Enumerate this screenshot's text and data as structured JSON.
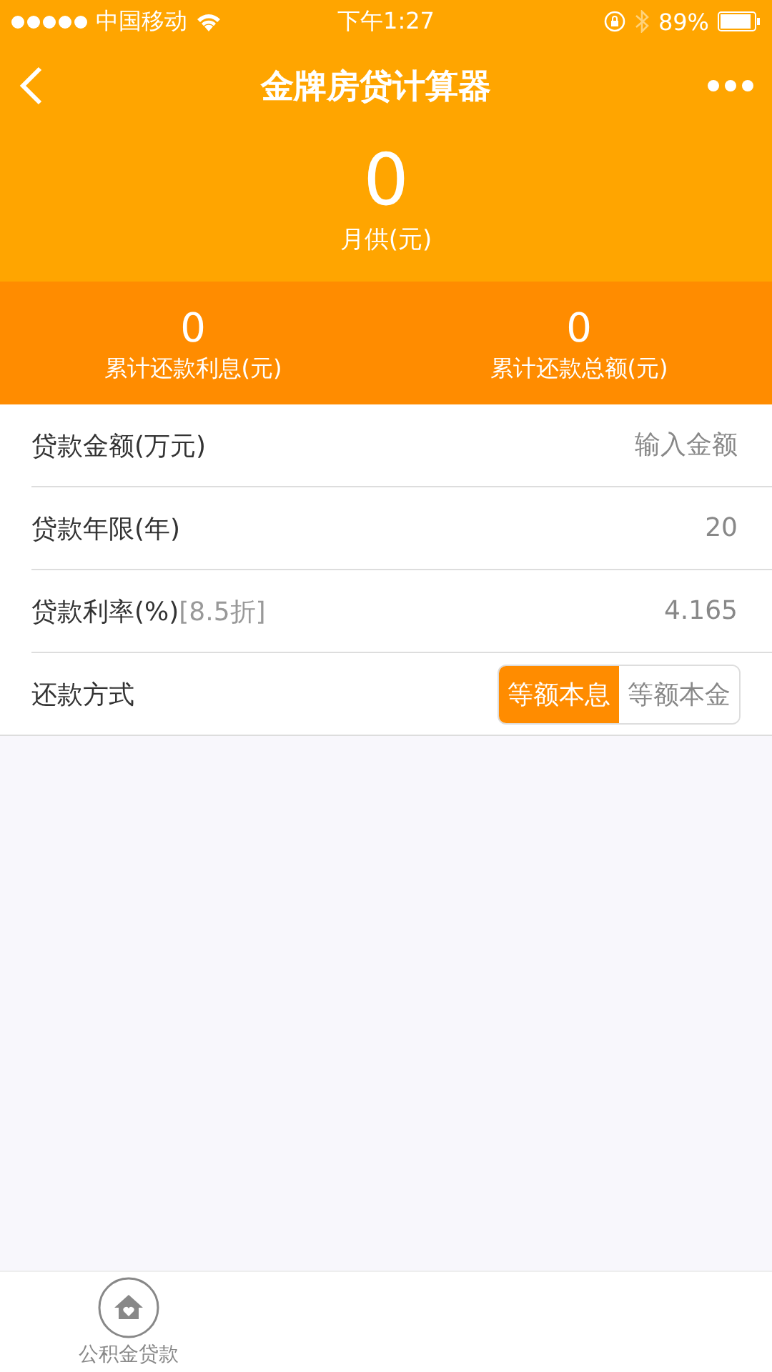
{
  "status_bar": {
    "carrier": "中国移动",
    "time": "下午1:27",
    "battery": "89%"
  },
  "nav": {
    "title": "金牌房贷计算器"
  },
  "summary": {
    "value": "0",
    "label": "月供(元)"
  },
  "totals": [
    {
      "value": "0",
      "label": "累计还款利息(元)"
    },
    {
      "value": "0",
      "label": "累计还款总额(元)"
    }
  ],
  "fields": [
    {
      "kind": "input",
      "label": "贷款金额(万元)",
      "placeholder": "输入金额"
    },
    {
      "kind": "input",
      "label": "贷款年限(年)",
      "value": "20"
    },
    {
      "kind": "input",
      "label": "贷款利率(%)",
      "note": "[8.5折]",
      "value": "4.165"
    },
    {
      "kind": "segmented",
      "label": "还款方式",
      "options": [
        {
          "label": "等额本息",
          "selected": true
        },
        {
          "label": "等额本金",
          "selected": false
        }
      ]
    }
  ],
  "tab_bar": [
    {
      "label": "公积金贷款",
      "selected": false
    }
  ]
}
